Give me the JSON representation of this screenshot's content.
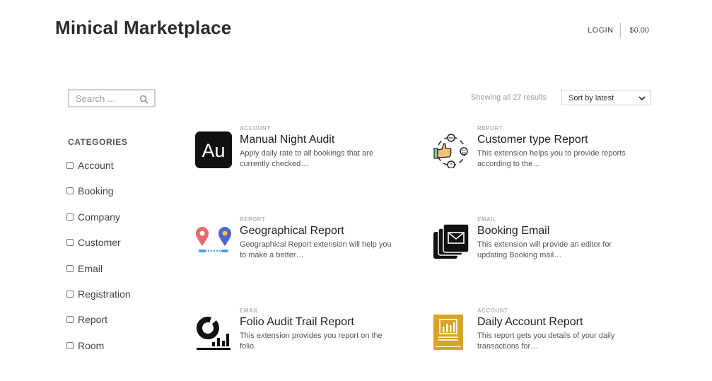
{
  "header": {
    "site_title": "Minical Marketplace",
    "login_label": "LOGIN",
    "cart_total": "$0.00"
  },
  "search": {
    "placeholder": "Search ..."
  },
  "sidebar": {
    "categories_heading": "CATEGORIES",
    "categories": [
      "Account",
      "Booking",
      "Company",
      "Customer",
      "Email",
      "Registration",
      "Report",
      "Room"
    ]
  },
  "results": {
    "count_text": "Showing all 27 results",
    "sort_selected": "Sort by latest"
  },
  "products": [
    {
      "category": "ACCOUNT",
      "title": "Manual Night Audit",
      "description": "Apply daily rate to all bookings that are currently checked…",
      "icon": "au-icon",
      "thumb_text": "Au"
    },
    {
      "category": "REPORT",
      "title": "Customer type Report",
      "description": "This extension helps you to provide reports according to the…",
      "icon": "customer-feedback-icon"
    },
    {
      "category": "REPORT",
      "title": "Geographical Report",
      "description": "Geographical Report extension will help you to make a better…",
      "icon": "map-pins-icon"
    },
    {
      "category": "EMAIL",
      "title": "Booking Email",
      "description": "This extension will provide an editor for updating Booking mail…",
      "icon": "email-stack-icon"
    },
    {
      "category": "EMAIL",
      "title": "Folio Audit Trail Report",
      "description": "This extension provides you report on the folio.",
      "icon": "pie-bar-chart-icon"
    },
    {
      "category": "ACCOUNT",
      "title": "Daily Account Report",
      "description": "This report gets you details of your daily transactions for…",
      "icon": "account-book-icon"
    }
  ],
  "colors": {
    "au_bg": "#111111",
    "pin_red": "#e86a6f",
    "pin_blue": "#4f66c9",
    "route_blue": "#39a6e8",
    "book_gold": "#d9a520"
  }
}
